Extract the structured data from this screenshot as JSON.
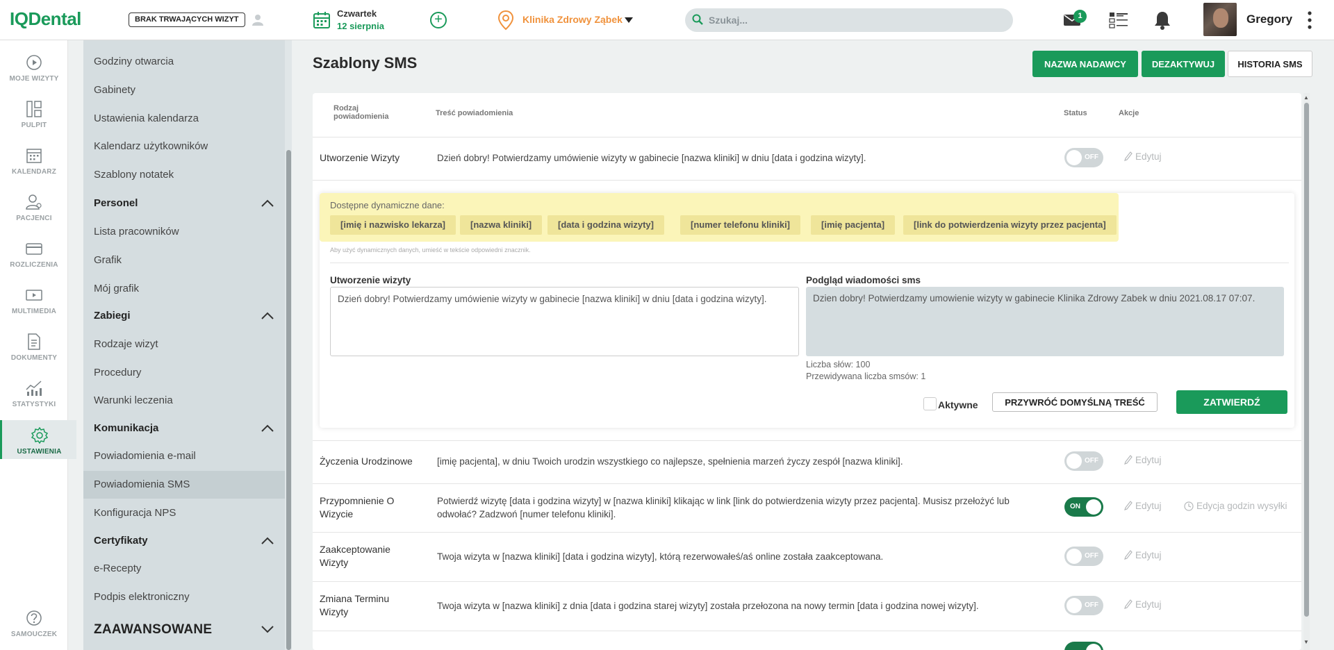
{
  "header": {
    "logo": "IQDental",
    "no_visits": "BRAK TRWAJĄCYCH WIZYT",
    "date_day": "Czwartek",
    "date_num": "12 sierpnia",
    "clinic": "Klinika Zdrowy Ząbek",
    "search_placeholder": "Szukaj...",
    "mail_badge": "1",
    "user_name": "Gregory"
  },
  "leftnav": [
    {
      "label": "MOJE WIZYTY",
      "icon": "play-circle-icon"
    },
    {
      "label": "PULPIT",
      "icon": "dashboard-icon"
    },
    {
      "label": "KALENDARZ",
      "icon": "calendar-icon"
    },
    {
      "label": "PACJENCI",
      "icon": "patients-icon"
    },
    {
      "label": "ROZLICZENIA",
      "icon": "card-icon"
    },
    {
      "label": "MULTIMEDIA",
      "icon": "media-icon"
    },
    {
      "label": "DOKUMENTY",
      "icon": "document-icon"
    },
    {
      "label": "STATYSTYKI",
      "icon": "stats-icon"
    },
    {
      "label": "USTAWIENIA",
      "icon": "gear-icon"
    },
    {
      "label": "SAMOUCZEK",
      "icon": "help-icon"
    }
  ],
  "sidebar": {
    "items_top": [
      "Godziny otwarcia",
      "Gabinety",
      "Ustawienia kalendarza",
      "Kalendarz użytkowników",
      "Szablony notatek"
    ],
    "personel": {
      "title": "Personel",
      "items": [
        "Lista pracowników",
        "Grafik",
        "Mój grafik"
      ]
    },
    "zabiegi": {
      "title": "Zabiegi",
      "items": [
        "Rodzaje wizyt",
        "Procedury",
        "Warunki leczenia"
      ]
    },
    "komunikacja": {
      "title": "Komunikacja",
      "items": [
        "Powiadomienia e-mail",
        "Powiadomienia SMS",
        "Konfiguracja NPS"
      ]
    },
    "certyfikaty": {
      "title": "Certyfikaty",
      "items": [
        "e-Recepty",
        "Podpis elektroniczny"
      ]
    },
    "zaawansowane": "ZAAWANSOWANE"
  },
  "main": {
    "title": "Szablony SMS",
    "btn_sender": "NAZWA NADAWCY",
    "btn_deactivate": "DEZAKTYWUJ",
    "btn_history": "HISTORIA SMS",
    "th_type_1": "Rodzaj",
    "th_type_2": "powiadomienia",
    "th_content": "Treść powiadomienia",
    "th_status": "Status",
    "th_actions": "Akcje",
    "edit_label": "Edytuj",
    "hours_label": "Edycja godzin wysyłki",
    "off_label": "OFF",
    "on_label": "ON",
    "rows": [
      {
        "type": "Utworzenie Wizyty",
        "text": "Dzień dobry! Potwierdzamy umówienie wizyty w gabinecie [nazwa kliniki] w dniu [data i godzina wizyty].",
        "status": "OFF"
      },
      {
        "type": "Życzenia Urodzinowe",
        "text": "[imię pacjenta], w dniu Twoich urodzin wszystkiego co najlepsze, spełnienia marzeń życzy zespół [nazwa kliniki].",
        "status": "OFF"
      },
      {
        "type": "Przypomnienie O Wizycie",
        "text": "Potwierdź wizytę [data i godzina wizyty] w [nazwa kliniki] klikając w link [link do potwierdzenia wizyty przez pacjenta]. Musisz przełożyć lub odwołać? Zadzwoń [numer telefonu kliniki].",
        "status": "ON"
      },
      {
        "type": "Zaakceptowanie Wizyty",
        "text": "Twoja wizyta w [nazwa kliniki] [data i godzina wizyty], którą rezerwowałeś/aś online została zaakceptowana.",
        "status": "OFF"
      },
      {
        "type": "Zmiana Terminu Wizyty",
        "text": "Twoja wizyta w [nazwa kliniki] z dnia [data i godzina starej wizyty] została przełozona na nowy termin [data i godzina nowej wizyty].",
        "status": "OFF"
      }
    ],
    "panel": {
      "dyn_title": "Dostępne dynamiczne dane:",
      "chips": [
        "[imię i nazwisko lekarza]",
        "[nazwa kliniki]",
        "[data i godzina wizyty]",
        "[numer telefonu kliniki]",
        "[imię pacjenta]",
        "[link do potwierdzenia wizyty przez pacjenta]"
      ],
      "hint": "Aby użyć dynamicznych danych, umieść w tekście odpowiedni znacznik.",
      "editor_label": "Utworzenie wizyty",
      "editor_value": "Dzień dobry! Potwierdzamy umówienie wizyty w gabinecie [nazwa kliniki] w dniu [data i godzina wizyty].",
      "preview_label": "Podgląd wiadomości sms",
      "preview_text": "Dzien dobry! Potwierdzamy umowienie wizyty w gabinecie Klinika Zdrowy Zabek w dniu 2021.08.17 07:07.",
      "word_count": "Liczba słów: 100",
      "sms_count": "Przewidywana liczba smsów: 1",
      "active_label": "Aktywne",
      "reset_button": "PRZYWRÓĆ DOMYŚLNĄ TREŚĆ",
      "confirm_button": "ZATWIERDŹ"
    }
  },
  "colors": {
    "accent": "#1a9a5a",
    "clinic": "#f0923c",
    "sidebar": "#d5dde0",
    "dyn_box": "#fbf5b9"
  }
}
